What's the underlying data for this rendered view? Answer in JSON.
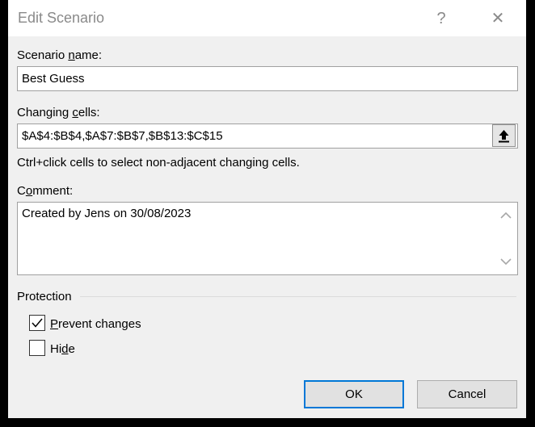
{
  "window": {
    "title": "Edit Scenario",
    "help_glyph": "?",
    "close_glyph": "✕"
  },
  "scenario_name": {
    "label_before": "Scenario ",
    "label_accel": "n",
    "label_after": "ame:",
    "value": "Best Guess"
  },
  "changing_cells": {
    "label_before": "Changing ",
    "label_accel": "c",
    "label_after": "ells:",
    "value": "$A$4:$B$4,$A$7:$B$7,$B$13:$C$15",
    "hint": "Ctrl+click cells to select non-adjacent changing cells."
  },
  "comment": {
    "label_before": "C",
    "label_accel": "o",
    "label_after": "mment:",
    "value": "Created by Jens on 30/08/2023"
  },
  "protection": {
    "heading": "Protection",
    "prevent_changes": {
      "accel": "P",
      "rest": "revent changes",
      "checked": true
    },
    "hide": {
      "before": "Hi",
      "accel": "d",
      "after": "e",
      "checked": false
    }
  },
  "buttons": {
    "ok": "OK",
    "cancel": "Cancel"
  },
  "colors": {
    "accent": "#0078d7",
    "title_text": "#8a8a8a"
  },
  "icons": [
    "help-icon",
    "close-icon",
    "collapse-dialog-icon",
    "scroll-up-icon",
    "scroll-down-icon",
    "checkmark-icon"
  ]
}
